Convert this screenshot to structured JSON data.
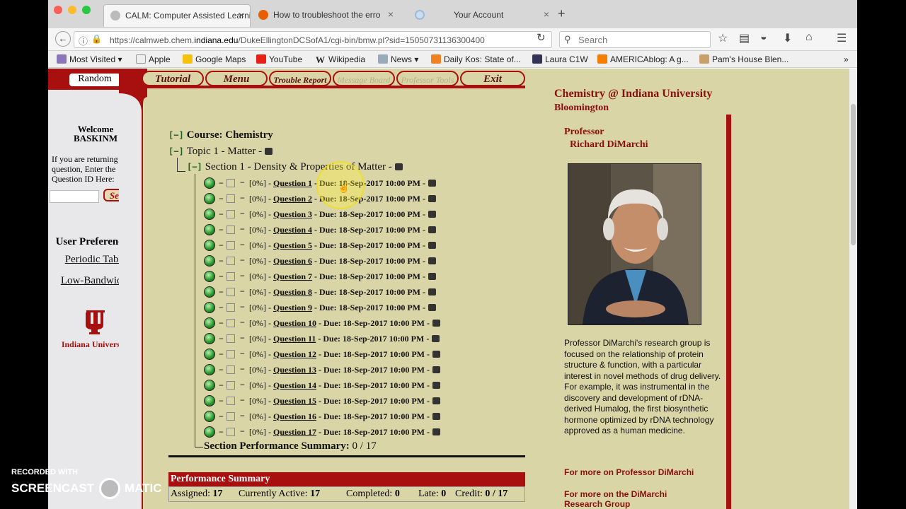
{
  "browser": {
    "tabs": [
      {
        "label": "CALM: Computer Assisted Learni",
        "active": true
      },
      {
        "label": "How to troubleshoot the erro",
        "active": false
      },
      {
        "label": "Your Account",
        "active": false
      }
    ],
    "url_prefix": "https://calmweb.chem.",
    "url_domain": "indiana.edu",
    "url_suffix": "/DukeEllingtonDCSofA1/cgi-bin/bmw.pl?sid=15050731136300400",
    "search_placeholder": "Search",
    "bookmarks": [
      "Most Visited",
      "Apple",
      "Google Maps",
      "YouTube",
      "Wikipedia",
      "News",
      "Daily Kos: State of...",
      "Laura C1W",
      "AMERICAblog: A g...",
      "Pam's House Blen..."
    ]
  },
  "sidebar": {
    "random_label": "Random",
    "welcome": "Welcome",
    "username": "BASKINM",
    "returning_text": "If you are returning to a question, Enter the Question ID Here:",
    "set_id_label": "Set ID",
    "prefs_title": "User Preferences:",
    "periodic_table": "Periodic Table",
    "low_bandwidth": "Low-Bandwidth",
    "iu_logo_text": "Indiana University"
  },
  "topnav": {
    "tutorial": "Tutorial",
    "menu": "Menu",
    "trouble": "Trouble Report",
    "message_board": "Message Board",
    "professor_tools": "Professor Tools",
    "exit": "Exit"
  },
  "tree": {
    "course": "Course: Chemistry",
    "topic": "Topic 1 - Matter -",
    "section": "Section 1 - Density & Properties of Matter -",
    "questions": [
      {
        "pct": "[0%]",
        "label": "Question 1",
        "due": "- Due: 18-Sep-2017 10:00 PM -"
      },
      {
        "pct": "[0%]",
        "label": "Question 2",
        "due": "- Due: 18-Sep-2017 10:00 PM -"
      },
      {
        "pct": "[0%]",
        "label": "Question 3",
        "due": "- Due: 18-Sep-2017 10:00 PM -"
      },
      {
        "pct": "[0%]",
        "label": "Question 4",
        "due": "- Due: 18-Sep-2017 10:00 PM -"
      },
      {
        "pct": "[0%]",
        "label": "Question 5",
        "due": "- Due: 18-Sep-2017 10:00 PM -"
      },
      {
        "pct": "[0%]",
        "label": "Question 6",
        "due": "- Due: 18-Sep-2017 10:00 PM -"
      },
      {
        "pct": "[0%]",
        "label": "Question 7",
        "due": "- Due: 18-Sep-2017 10:00 PM -"
      },
      {
        "pct": "[0%]",
        "label": "Question 8",
        "due": "- Due: 18-Sep-2017 10:00 PM -"
      },
      {
        "pct": "[0%]",
        "label": "Question 9",
        "due": "- Due: 18-Sep-2017 10:00 PM -"
      },
      {
        "pct": "[0%]",
        "label": "Question 10",
        "due": "- Due: 18-Sep-2017 10:00 PM -"
      },
      {
        "pct": "[0%]",
        "label": "Question 11",
        "due": "- Due: 18-Sep-2017 10:00 PM -"
      },
      {
        "pct": "[0%]",
        "label": "Question 12",
        "due": "- Due: 18-Sep-2017 10:00 PM -"
      },
      {
        "pct": "[0%]",
        "label": "Question 13",
        "due": "- Due: 18-Sep-2017 10:00 PM -"
      },
      {
        "pct": "[0%]",
        "label": "Question 14",
        "due": "- Due: 18-Sep-2017 10:00 PM -"
      },
      {
        "pct": "[0%]",
        "label": "Question 15",
        "due": "- Due: 18-Sep-2017 10:00 PM -"
      },
      {
        "pct": "[0%]",
        "label": "Question 16",
        "due": "- Due: 18-Sep-2017 10:00 PM -"
      },
      {
        "pct": "[0%]",
        "label": "Question 17",
        "due": "- Due: 18-Sep-2017 10:00 PM -"
      }
    ],
    "section_summary_label": "Section Performance Summary:",
    "section_summary_value": "0 / 17"
  },
  "performance": {
    "title": "Performance Summary",
    "assigned_label": "Assigned:",
    "assigned": "17",
    "active_label": "Currently Active:",
    "active": "17",
    "completed_label": "Completed:",
    "completed": "0",
    "late_label": "Late:",
    "late": "0",
    "credit_label": "Credit:",
    "credit": "0 / 17"
  },
  "right": {
    "title": "Chemistry @ Indiana University",
    "subtitle": "Bloomington",
    "professor_label": "Professor",
    "professor_name": "Richard DiMarchi",
    "bio": "Professor DiMarchi's research group is focused on the relationship of protein structure & function, with a particular interest in novel methods of drug delivery. For example, it was instrumental in the discovery and development of rDNA-derived Humalog, the first biosynthetic hormone optimized by rDNA technology approved as a human medicine.",
    "link1": "For more on Professor DiMarchi",
    "link2": "For more on the DiMarchi Research Group"
  },
  "watermark": {
    "line1": "RECORDED WITH",
    "line2a": "SCREENCAST",
    "line2b": "MATIC"
  },
  "colors": {
    "crimson": "#a80f0f",
    "page_bg": "#d9d5a6"
  }
}
